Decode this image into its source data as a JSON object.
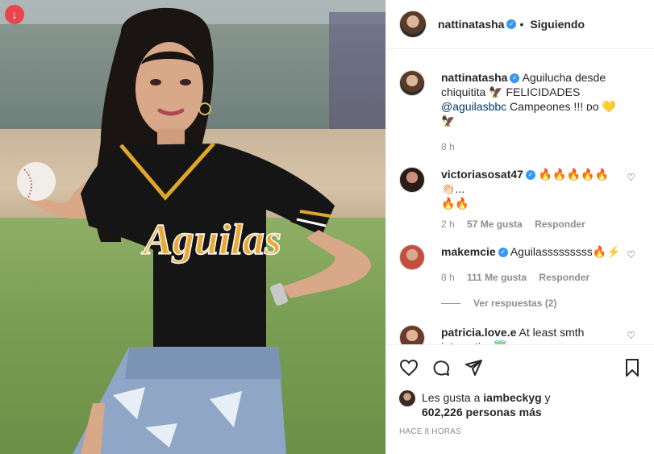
{
  "post": {
    "author": "nattinatasha",
    "follow_status": "Siguiendo",
    "caption_part1": "Aguilucha desde chiquitita",
    "caption_emoji1": "🦅",
    "caption_part2": "FELICIDADES",
    "caption_mention": "@aguilasbbc",
    "caption_part3": "Campeones !!! ᴅᴏ",
    "caption_emoji2": "💛🦅",
    "caption_time": "8 h",
    "download_icon": "download-arrow-icon",
    "jersey_text": "Aguilas"
  },
  "comments": [
    {
      "user": "victoriasosat47",
      "verified": true,
      "text": "🔥🔥🔥🔥🔥👏🏻...",
      "text2": "🔥🔥",
      "time": "2 h",
      "likes": "57 Me gusta",
      "reply": "Responder"
    },
    {
      "user": "makemcie",
      "verified": true,
      "text": "Aguilasssssssss🔥⚡",
      "time": "8 h",
      "likes": "111 Me gusta",
      "reply": "Responder",
      "view_replies": "Ver respuestas (2)"
    },
    {
      "user": "patricia.love.e",
      "verified": false,
      "text": "At least smth interesting😇"
    }
  ],
  "likes_summary": {
    "prefix": "Les gusta a",
    "user": "iambeckyg",
    "suffix": "y",
    "count_text": "602,226 personas más"
  },
  "timestamp": "HACE 8 HORAS",
  "colors": {
    "verified": "#3897f0",
    "download_button": "#e8464f",
    "muted": "#8e8e8e",
    "link": "#00376b"
  },
  "icons": [
    "heart-icon",
    "comment-icon",
    "share-icon",
    "bookmark-icon"
  ]
}
